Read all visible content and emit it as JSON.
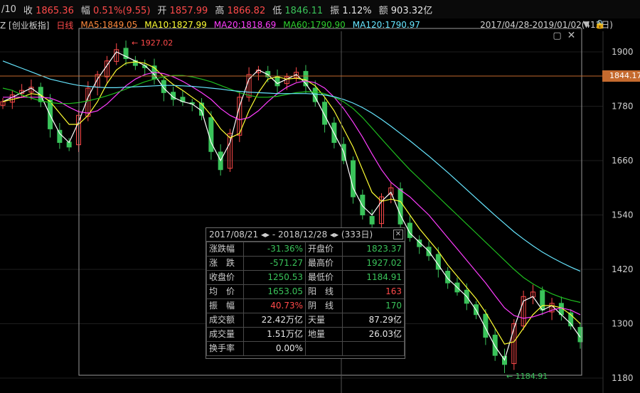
{
  "quote_bar": {
    "date_fragment": "/10",
    "close_label": "收",
    "close_value": "1865.36",
    "change_label": "幅",
    "change_value": "0.51%(9.55)",
    "open_label": "开",
    "open_value": "1857.99",
    "high_label": "高",
    "high_value": "1866.82",
    "low_label": "低",
    "low_value": "1846.11",
    "amplitude_label": "振",
    "amplitude_value": "1.12%",
    "amount_label": "额",
    "amount_value": "903.32亿"
  },
  "ma_bar": {
    "index_name": "Z [创业板指]",
    "period": "日线",
    "ma5": "MA5:1849.05",
    "ma10": "MA10:1827.99",
    "ma20": "MA20:1818.69",
    "ma60": "MA60:1790.90",
    "ma120": "MA120:1790.97",
    "date_range": "2017/04/28-2019/01/02(412日)"
  },
  "colors": {
    "up": "#ff4a4a",
    "down": "#3ac35a",
    "ma5": "#ffffff",
    "ma10": "#ffff33",
    "ma20": "#ff3dff",
    "ma60": "#1fbf1f",
    "ma120": "#66e6ff",
    "accent": "#c56a2e"
  },
  "chart_data": {
    "type": "candlestick",
    "y_ticks": [
      "1900",
      "1780",
      "1660",
      "1540",
      "1420",
      "1300",
      "1180"
    ],
    "ylim": [
      1160,
      1960
    ],
    "current_price_label": "1844.17",
    "high_annotation": "1927.02",
    "low_annotation": "1184.91",
    "series": [
      {
        "name": "MA5",
        "values": [
          1790,
          1800,
          1810,
          1820,
          1805,
          1760,
          1720,
          1700,
          1745,
          1800,
          1840,
          1870,
          1900,
          1890,
          1880,
          1870,
          1850,
          1820,
          1800,
          1790,
          1785,
          1770,
          1700,
          1660,
          1700,
          1780,
          1840,
          1860,
          1850,
          1830,
          1840,
          1850,
          1830,
          1800,
          1760,
          1720,
          1680,
          1600,
          1560,
          1540,
          1570,
          1590,
          1540,
          1500,
          1480,
          1460,
          1430,
          1400,
          1380,
          1360,
          1330,
          1290,
          1250,
          1220,
          1290,
          1350,
          1360,
          1330,
          1340,
          1320,
          1300,
          1270
        ]
      },
      {
        "name": "MA10",
        "values": [
          1790,
          1795,
          1800,
          1808,
          1805,
          1790,
          1765,
          1740,
          1740,
          1760,
          1790,
          1830,
          1860,
          1875,
          1878,
          1875,
          1865,
          1845,
          1828,
          1815,
          1800,
          1785,
          1760,
          1730,
          1710,
          1720,
          1770,
          1810,
          1840,
          1845,
          1840,
          1842,
          1838,
          1825,
          1800,
          1770,
          1730,
          1690,
          1640,
          1590,
          1570,
          1575,
          1570,
          1540,
          1510,
          1485,
          1460,
          1430,
          1405,
          1380,
          1355,
          1325,
          1290,
          1255,
          1260,
          1290,
          1320,
          1340,
          1340,
          1335,
          1320,
          1300
        ]
      },
      {
        "name": "MA20",
        "values": [
          1800,
          1800,
          1800,
          1800,
          1800,
          1798,
          1790,
          1778,
          1768,
          1765,
          1770,
          1785,
          1805,
          1825,
          1840,
          1850,
          1855,
          1852,
          1845,
          1835,
          1823,
          1810,
          1795,
          1775,
          1760,
          1750,
          1755,
          1770,
          1790,
          1808,
          1822,
          1832,
          1836,
          1832,
          1820,
          1800,
          1775,
          1745,
          1712,
          1675,
          1640,
          1612,
          1595,
          1580,
          1560,
          1540,
          1515,
          1490,
          1465,
          1440,
          1415,
          1390,
          1362,
          1335,
          1318,
          1312,
          1315,
          1322,
          1330,
          1335,
          1330,
          1320
        ]
      },
      {
        "name": "MA60",
        "values": [
          1820,
          1815,
          1805,
          1798,
          1792,
          1788,
          1786,
          1786,
          1788,
          1792,
          1797,
          1803,
          1810,
          1818,
          1826,
          1834,
          1840,
          1845,
          1848,
          1848,
          1845,
          1840,
          1834,
          1826,
          1818,
          1810,
          1804,
          1800,
          1800,
          1802,
          1806,
          1810,
          1812,
          1812,
          1808,
          1800,
          1790,
          1775,
          1755,
          1732,
          1708,
          1685,
          1662,
          1640,
          1620,
          1600,
          1580,
          1560,
          1540,
          1520,
          1500,
          1480,
          1460,
          1440,
          1420,
          1402,
          1388,
          1376,
          1366,
          1358,
          1352,
          1347
        ]
      },
      {
        "name": "MA120",
        "values": [
          1880,
          1872,
          1864,
          1856,
          1848,
          1840,
          1835,
          1830,
          1826,
          1824,
          1822,
          1821,
          1821,
          1822,
          1823,
          1824,
          1825,
          1826,
          1826,
          1825,
          1824,
          1822,
          1820,
          1818,
          1815,
          1813,
          1811,
          1810,
          1809,
          1808,
          1808,
          1808,
          1808,
          1807,
          1805,
          1801,
          1795,
          1787,
          1777,
          1765,
          1751,
          1736,
          1720,
          1704,
          1687,
          1670,
          1652,
          1634,
          1615,
          1596,
          1577,
          1558,
          1539,
          1521,
          1503,
          1487,
          1472,
          1458,
          1446,
          1435,
          1425,
          1416
        ]
      }
    ],
    "closes": [
      1790,
      1805,
      1815,
      1822,
      1790,
      1730,
      1700,
      1690,
      1760,
      1820,
      1850,
      1880,
      1905,
      1885,
      1870,
      1865,
      1840,
      1810,
      1795,
      1790,
      1785,
      1760,
      1680,
      1640,
      1720,
      1800,
      1850,
      1860,
      1845,
      1825,
      1845,
      1855,
      1825,
      1790,
      1740,
      1700,
      1660,
      1580,
      1540,
      1520,
      1580,
      1600,
      1520,
      1490,
      1470,
      1450,
      1420,
      1390,
      1370,
      1345,
      1320,
      1270,
      1230,
      1210,
      1300,
      1360,
      1370,
      1330,
      1345,
      1320,
      1295,
      1260
    ]
  },
  "stats_panel": {
    "range_start": "2017/08/21",
    "range_sep": "-",
    "range_end": "2018/12/28",
    "days": "(333日)",
    "rows": [
      {
        "k1": "涨跌幅",
        "v1": "-31.36%",
        "k2": "开盘价",
        "v2": "1823.37"
      },
      {
        "k1": "涨　跌",
        "v1": "-571.27",
        "k2": "最高价",
        "v2": "1927.02"
      },
      {
        "k1": "收盘价",
        "v1": "1250.53",
        "k2": "最低价",
        "v2": "1184.91"
      },
      {
        "k1": "均　价",
        "v1": "1653.05",
        "k2": "阳　线",
        "v2": "163"
      },
      {
        "k1": "振　幅",
        "v1": "40.73%",
        "k2": "阴　线",
        "v2": "170"
      },
      {
        "k1": "成交额",
        "v1": "22.42万亿",
        "k2": "天量",
        "v2": "87.29亿"
      },
      {
        "k1": "成交量",
        "v1": "1.51万亿",
        "k2": "地量",
        "v2": "26.03亿"
      },
      {
        "k1": "换手率",
        "v1": "0.00%",
        "k2": "",
        "v2": ""
      }
    ]
  }
}
